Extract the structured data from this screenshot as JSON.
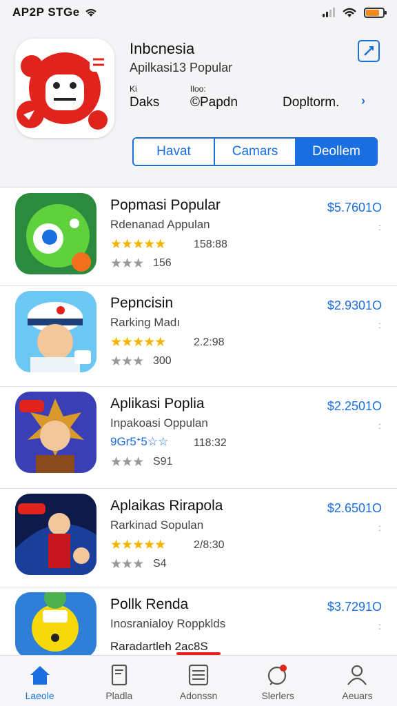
{
  "status_bar": {
    "carrier": "AP2P STGe",
    "battery_percent": 80
  },
  "header": {
    "title": "Inbcnesia",
    "subtitle": "Apilkasi13 Popular",
    "meta": [
      {
        "label": "Ki",
        "value": "Daks"
      },
      {
        "label": "Iloo:",
        "value": "©Papdn"
      },
      {
        "label": "",
        "value": "Dopltorm."
      }
    ],
    "segments": [
      "Havat",
      "Camars",
      "Deollem"
    ]
  },
  "apps": [
    {
      "name": "Popmasi Popular",
      "category": "Rdenanad Appulan",
      "stars": "★★★★★",
      "count": "158:88",
      "gray_stars": "★★★",
      "gray_count": "156",
      "price": "$5.7601O"
    },
    {
      "name": "Pepncisin",
      "category": "Rarking Madı",
      "stars": "★★★★★",
      "count": "2.2:98",
      "gray_stars": "★★★",
      "gray_count": "300",
      "price": "$2.9301O"
    },
    {
      "name": "Aplikasi Poplia",
      "category": "Inpakoasi Oppulan",
      "stars": "9Gr5ᐩ5☆☆",
      "count": "118:32",
      "gray_stars": "★★★",
      "gray_count": "S91",
      "price": "$2.2501O"
    },
    {
      "name": "Aplaikas Rirapola",
      "category": "Rarkinad Sopulan",
      "stars": "★★★★★",
      "count": "2/8:30",
      "gray_stars": "★★★",
      "gray_count": "S4",
      "price": "$2.6501O"
    },
    {
      "name": "Pollk Renda",
      "category": "Inosranialoy Roppklds",
      "stars": "",
      "count": "",
      "gray_stars": "",
      "gray_count": "Raradartleh 2ac8S",
      "price": "$3.7291O"
    }
  ],
  "tabs": [
    {
      "label": "Laeole",
      "icon": "home-icon"
    },
    {
      "label": "Pladla",
      "icon": "book-icon"
    },
    {
      "label": "Adonssn",
      "icon": "list-icon"
    },
    {
      "label": "Slerlers",
      "icon": "bell-icon"
    },
    {
      "label": "Aeuars",
      "icon": "person-icon"
    }
  ]
}
